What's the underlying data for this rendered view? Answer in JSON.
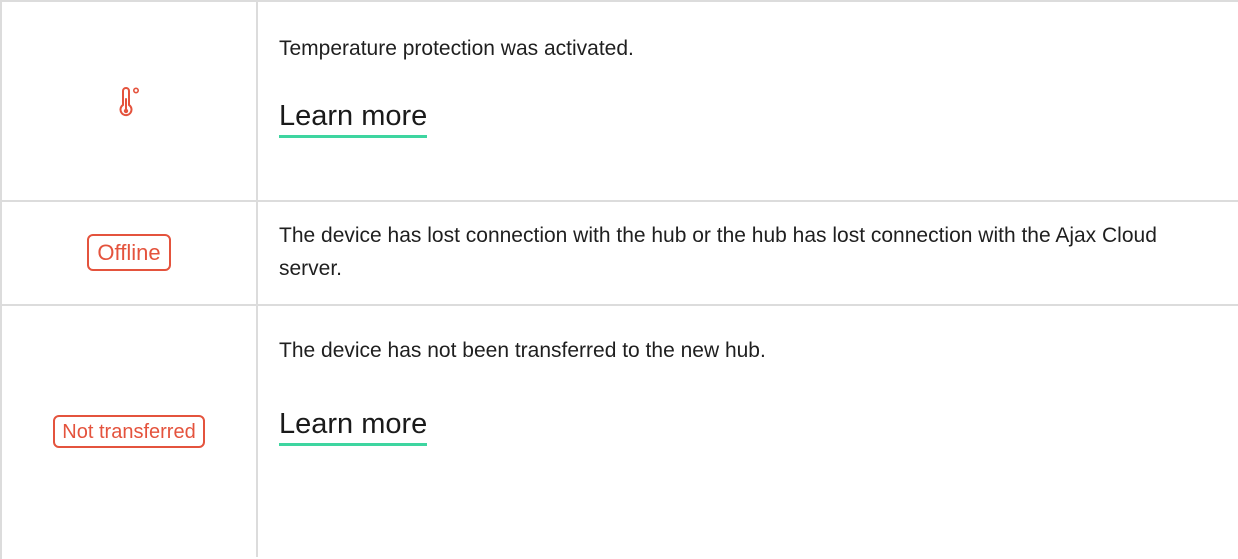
{
  "rows": [
    {
      "icon": "thermometer-icon",
      "description": "Temperature protection was activated.",
      "link": "Learn more"
    },
    {
      "badge": "Offline",
      "description": "The device has lost connection with the hub or the hub has lost connection with the Ajax Cloud server."
    },
    {
      "badge": "Not transferred",
      "description": "The device has not been transferred to the new hub.",
      "link": "Learn more"
    }
  ],
  "colors": {
    "accent": "#e4533d",
    "link_underline": "#3ed5a0",
    "border": "#dcdcdc"
  }
}
